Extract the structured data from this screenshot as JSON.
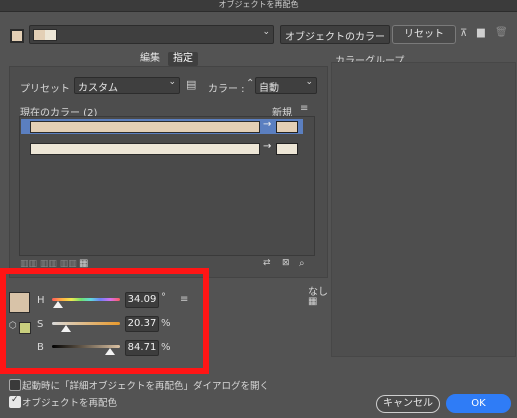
{
  "window": {
    "title": "オブジェクトを再配色"
  },
  "top_bar": {
    "color_dropdown_value": "",
    "object_colors_label": "オブジェクトのカラー",
    "reset_label": "リセット"
  },
  "tabs": {
    "edit_label": "編集",
    "assign_label": "指定"
  },
  "preset": {
    "label": "プリセット :",
    "value": "カスタム",
    "color_label": "カラー :",
    "color_value": "自動"
  },
  "current_colors": {
    "label": "現在のカラー (2)",
    "new_label": "新規",
    "rows": [
      {
        "current": "#e3cfb5",
        "new": "#e3cfb5",
        "selected": true
      },
      {
        "current": "#ede6d6",
        "new": "#ede6d6",
        "selected": false
      }
    ]
  },
  "color_group": {
    "label": "カラーグループ"
  },
  "hsb": {
    "h_label": "H",
    "h_value": "34.09",
    "h_unit": "°",
    "s_label": "S",
    "s_value": "20.37",
    "s_unit": "%",
    "b_label": "B",
    "b_value": "84.71",
    "b_unit": "%",
    "swatch_color": "#d8c3a8",
    "swatch_small_color": "#c9cf7e"
  },
  "none_label": "なし",
  "footer": {
    "open_on_start_label": "起動時に「詳細オブジェクトを再配色」ダイアログを開く",
    "open_on_start_checked": false,
    "recolor_label": "オブジェクトを再配色",
    "recolor_checked": true,
    "cancel_label": "キャンセル",
    "ok_label": "OK"
  },
  "colors": {
    "accent": "#2f7cf6",
    "highlight_red": "#ff1515"
  }
}
